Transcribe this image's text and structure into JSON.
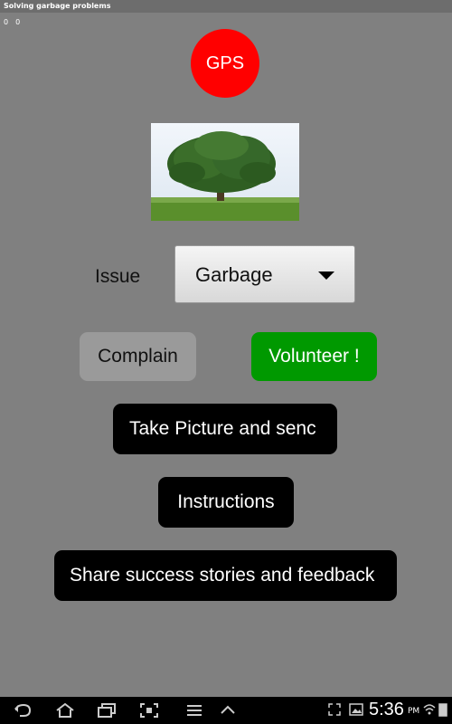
{
  "app": {
    "title": "Solving garbage problems"
  },
  "coords": {
    "lat": "0",
    "lon": "0"
  },
  "gps_button": {
    "label": "GPS",
    "color": "#ff0000"
  },
  "image": {
    "icon": "tree-photo"
  },
  "issue": {
    "label": "Issue",
    "selected": "Garbage"
  },
  "buttons": {
    "complain": "Complain",
    "volunteer": "Volunteer !",
    "take_picture": "Take Picture and senc",
    "instructions": "Instructions",
    "share": "Share success stories and feedback"
  },
  "colors": {
    "volunteer": "#009900",
    "dark_button": "#000000",
    "background": "#808080"
  },
  "status": {
    "time": "5:36",
    "ampm": "PM"
  }
}
